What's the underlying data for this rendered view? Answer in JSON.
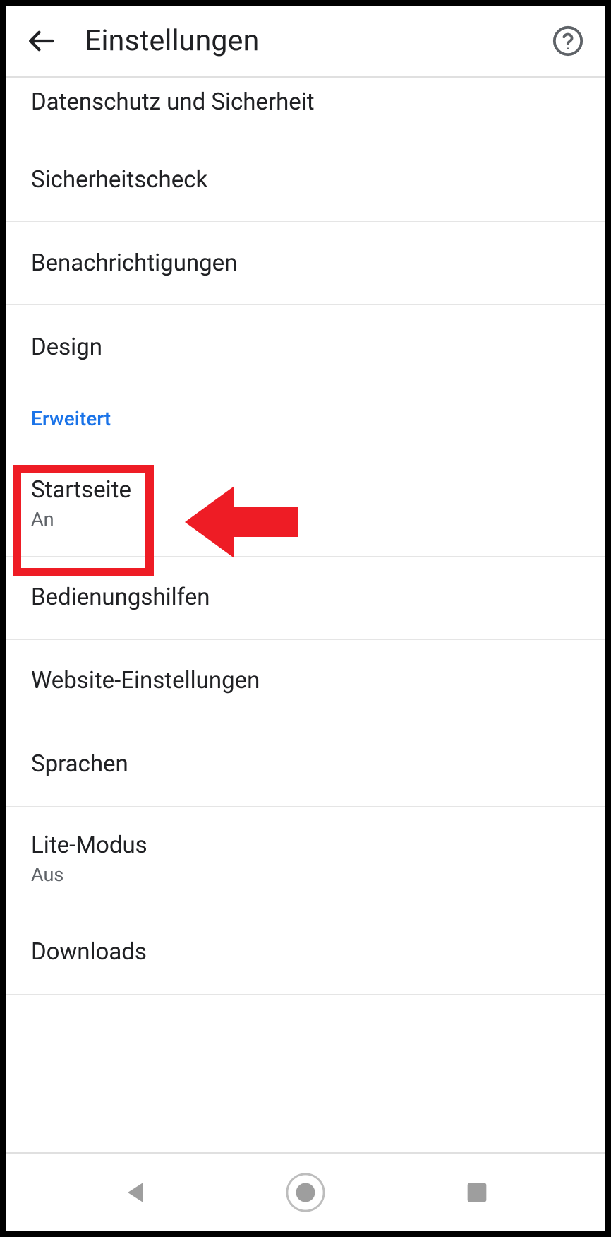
{
  "header": {
    "title": "Einstellungen"
  },
  "items": {
    "privacy": {
      "label": "Datenschutz und Sicherheit"
    },
    "safetycheck": {
      "label": "Sicherheitscheck"
    },
    "notifications": {
      "label": "Benachrichtigungen"
    },
    "design": {
      "label": "Design"
    }
  },
  "section": {
    "advanced": "Erweitert"
  },
  "advanced": {
    "homepage": {
      "label": "Startseite",
      "status": "An"
    },
    "accessibility": {
      "label": "Bedienungshilfen"
    },
    "sitesettings": {
      "label": "Website-Einstellungen"
    },
    "languages": {
      "label": "Sprachen"
    },
    "litemode": {
      "label": "Lite-Modus",
      "status": "Aus"
    },
    "downloads": {
      "label": "Downloads"
    }
  },
  "annotation": {
    "highlight_color": "#ee1c25"
  }
}
